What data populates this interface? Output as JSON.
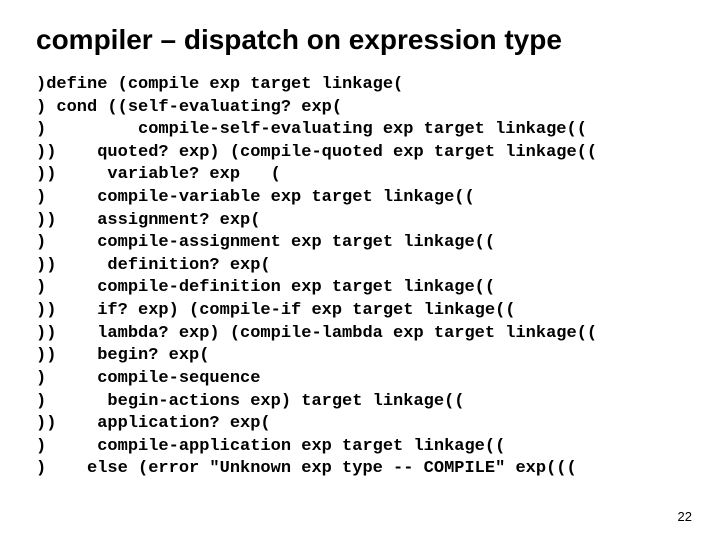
{
  "title": "compiler – dispatch on expression type",
  "code_lines": [
    ")define (compile exp target linkage(",
    ") cond ((self-evaluating? exp(",
    ")         compile-self-evaluating exp target linkage((",
    "))    quoted? exp) (compile-quoted exp target linkage((",
    "))     variable? exp   (",
    ")     compile-variable exp target linkage((",
    "))    assignment? exp(",
    ")     compile-assignment exp target linkage((",
    "))     definition? exp(",
    ")     compile-definition exp target linkage((",
    "))    if? exp) (compile-if exp target linkage((",
    "))    lambda? exp) (compile-lambda exp target linkage((",
    "))    begin? exp(",
    ")     compile-sequence",
    ")      begin-actions exp) target linkage((",
    "))    application? exp(",
    ")     compile-application exp target linkage((",
    ")    else (error \"Unknown exp type -- COMPILE\" exp((("
  ],
  "page_number": "22"
}
